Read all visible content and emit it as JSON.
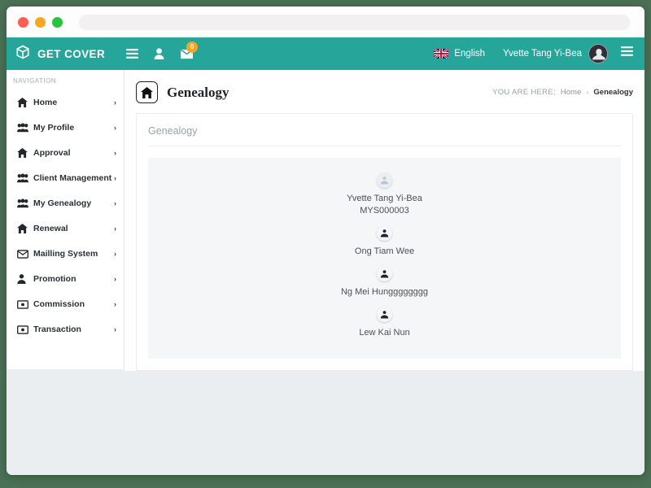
{
  "browser": {
    "url_placeholder": "",
    "url_value": "",
    "controls": [
      "close",
      "minimize",
      "maximize"
    ]
  },
  "topbar": {
    "brand": "GET COVER",
    "brand_icon": "cube-icon",
    "menu_icon": "hamburger-icon",
    "user_icon": "user-icon",
    "mail_icon": "envelope-icon",
    "mail_badge": "0",
    "language": "English",
    "language_flag": "uk-flag-icon",
    "user_name": "Yvette Tang Yi-Bea",
    "right_menu_icon": "hamburger-icon",
    "accent_color": "#26a69a",
    "badge_color": "#f5a623"
  },
  "sidebar": {
    "title": "NAVIGATION",
    "items": [
      {
        "label": "Home",
        "icon": "home-icon",
        "chevron": "›"
      },
      {
        "label": "My Profile",
        "icon": "users-icon",
        "chevron": "›"
      },
      {
        "label": "Approval",
        "icon": "home-icon",
        "chevron": "›"
      },
      {
        "label": "Client Management",
        "icon": "users-icon",
        "chevron": "›"
      },
      {
        "label": "My Genealogy",
        "icon": "users-icon",
        "chevron": "›"
      },
      {
        "label": "Renewal",
        "icon": "home-icon",
        "chevron": "›"
      },
      {
        "label": "Mailling System",
        "icon": "envelope-icon",
        "chevron": "›"
      },
      {
        "label": "Promotion",
        "icon": "person-icon",
        "chevron": "›"
      },
      {
        "label": "Commission",
        "icon": "money-icon",
        "chevron": "›"
      },
      {
        "label": "Transaction",
        "icon": "money-icon",
        "chevron": "›"
      }
    ]
  },
  "page": {
    "title": "Genealogy",
    "home_icon": "home-icon",
    "breadcrumb": {
      "label": "YOU ARE HERE:",
      "home": "Home",
      "separator": "›",
      "current": "Genealogy"
    },
    "card_title": "Genealogy"
  },
  "genealogy": {
    "nodes": [
      {
        "icon": "user-circle-icon",
        "name": "Yvette Tang Yi-Bea",
        "id": "MYS000003",
        "level": "root"
      },
      {
        "icon": "user-circle-icon",
        "name": "Ong Tiam Wee",
        "id": "",
        "level": "child"
      },
      {
        "icon": "user-circle-icon",
        "name": "Ng Mei Hungggggggg",
        "id": "",
        "level": "child"
      },
      {
        "icon": "user-circle-icon",
        "name": "Lew Kai Nun",
        "id": "",
        "level": "child"
      }
    ]
  }
}
